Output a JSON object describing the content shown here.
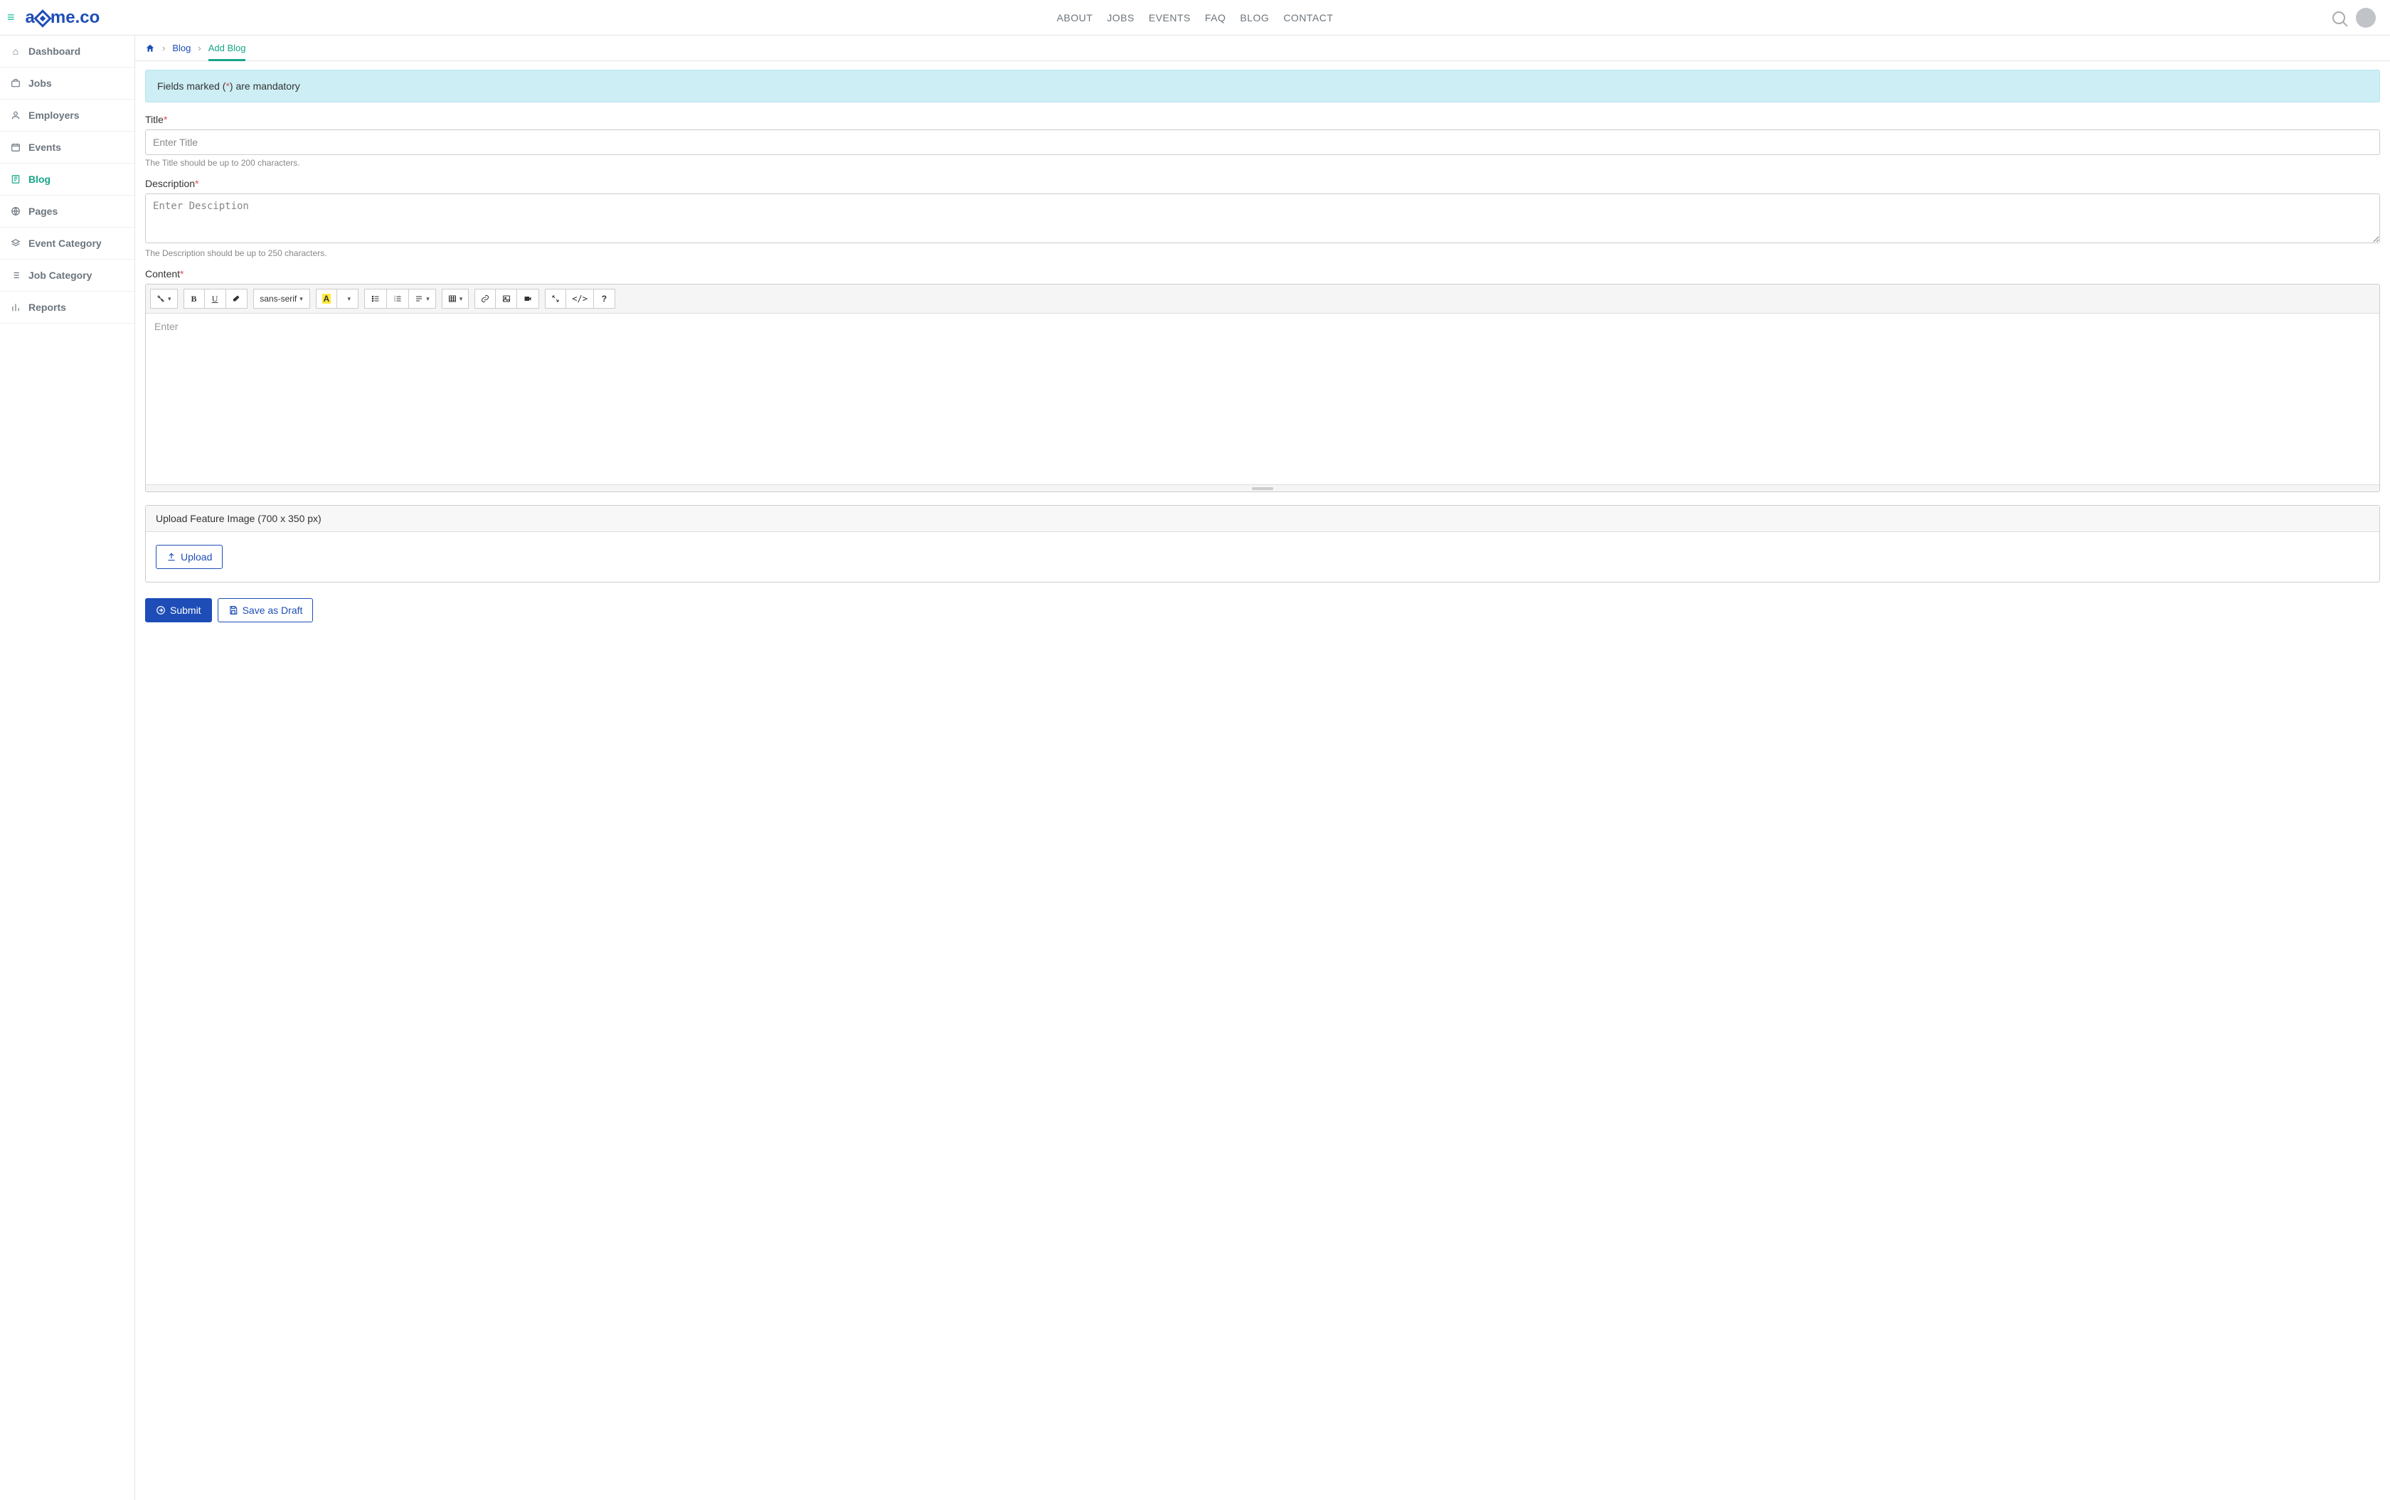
{
  "brand": {
    "prefix": "a",
    "suffix": "me.co"
  },
  "topnav": {
    "about": "ABOUT",
    "jobs": "JOBS",
    "events": "EVENTS",
    "faq": "FAQ",
    "blog": "BLOG",
    "contact": "CONTACT"
  },
  "sidebar": {
    "dashboard": "Dashboard",
    "jobs": "Jobs",
    "employers": "Employers",
    "events": "Events",
    "blog": "Blog",
    "pages": "Pages",
    "event_category": "Event Category",
    "job_category": "Job Category",
    "reports": "Reports"
  },
  "breadcrumb": {
    "blog": "Blog",
    "add_blog": "Add Blog"
  },
  "alert": {
    "pre": "Fields marked (",
    "star": "*",
    "post": ") are mandatory"
  },
  "fields": {
    "title": {
      "label": "Title",
      "placeholder": "Enter Title",
      "help": "The Title should be up to 200 characters."
    },
    "description": {
      "label": "Description",
      "placeholder": "Enter Desciption",
      "help": "The Description should be up to 250 characters."
    },
    "content": {
      "label": "Content",
      "placeholder": "Enter"
    }
  },
  "editor": {
    "font": "sans-serif"
  },
  "upload": {
    "heading": "Upload Feature Image (700 x 350 px)",
    "button": "Upload"
  },
  "actions": {
    "submit": "Submit",
    "draft": "Save as Draft"
  }
}
